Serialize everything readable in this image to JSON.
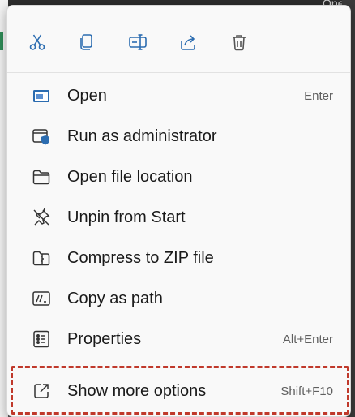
{
  "background": {
    "top_text": "Ope"
  },
  "toolbar": [
    {
      "icon": "scissors-icon",
      "name": "cut-button"
    },
    {
      "icon": "copy-icon",
      "name": "copy-button"
    },
    {
      "icon": "rename-icon",
      "name": "rename-button"
    },
    {
      "icon": "share-icon",
      "name": "share-button"
    },
    {
      "icon": "trash-icon",
      "name": "delete-button"
    }
  ],
  "menu": {
    "items": [
      {
        "label": "Open",
        "shortcut": "Enter",
        "icon": "app-window-icon"
      },
      {
        "label": "Run as administrator",
        "shortcut": "",
        "icon": "shield-window-icon"
      },
      {
        "label": "Open file location",
        "shortcut": "",
        "icon": "folder-icon"
      },
      {
        "label": "Unpin from Start",
        "shortcut": "",
        "icon": "unpin-icon"
      },
      {
        "label": "Compress to ZIP file",
        "shortcut": "",
        "icon": "zip-folder-icon"
      },
      {
        "label": "Copy as path",
        "shortcut": "",
        "icon": "path-icon"
      },
      {
        "label": "Properties",
        "shortcut": "Alt+Enter",
        "icon": "properties-icon"
      },
      {
        "label": "Show more options",
        "shortcut": "Shift+F10",
        "icon": "external-link-icon"
      }
    ]
  },
  "colors": {
    "accent_blue": "#2b6cb0",
    "highlight_border": "#c0392b",
    "menu_bg": "#f9f9f9"
  }
}
